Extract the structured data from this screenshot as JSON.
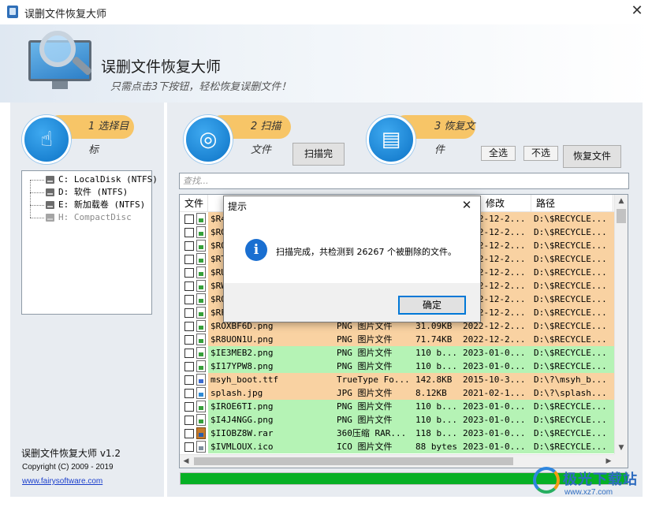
{
  "window": {
    "title": "误删文件恢复大师",
    "close_glyph": "✕"
  },
  "header": {
    "title": "误删文件恢复大师",
    "subtitle": "只需点击3下按钮，轻松恢复误删文件！"
  },
  "steps": [
    {
      "label": "1 选择目标",
      "icon": "hand-pointer-icon"
    },
    {
      "label": "2 扫描文件",
      "icon": "radar-scan-icon"
    },
    {
      "label": "3 恢复文件",
      "icon": "document-search-icon"
    }
  ],
  "buttons": {
    "scan_done": "扫描完",
    "select_all": "全选",
    "select_none": "不选",
    "recover": "恢复文件"
  },
  "drives": [
    {
      "label": "C: LocalDisk (NTFS)",
      "enabled": true
    },
    {
      "label": "D: 软件 (NTFS)",
      "enabled": true
    },
    {
      "label": "E: 新加载卷 (NTFS)",
      "enabled": true
    },
    {
      "label": "H: CompactDisc",
      "enabled": false
    }
  ],
  "search": {
    "placeholder": "查找..."
  },
  "table": {
    "columns": [
      "文件",
      "",
      "",
      "修改",
      "路径"
    ],
    "rows": [
      {
        "name": "$R4",
        "type": "",
        "size": "",
        "date": "2022-12-2...",
        "path": "D:\\$RECYCLE...",
        "color": "orange",
        "icon": "png"
      },
      {
        "name": "$RG",
        "type": "",
        "size": "",
        "date": "2022-12-2...",
        "path": "D:\\$RECYCLE...",
        "color": "orange",
        "icon": "png"
      },
      {
        "name": "$RQ",
        "type": "",
        "size": "",
        "date": "2022-12-2...",
        "path": "D:\\$RECYCLE...",
        "color": "orange",
        "icon": "png"
      },
      {
        "name": "$RT",
        "type": "",
        "size": "",
        "date": "2022-12-2...",
        "path": "D:\\$RECYCLE...",
        "color": "orange",
        "icon": "png"
      },
      {
        "name": "$RU",
        "type": "",
        "size": "",
        "date": "2022-12-2...",
        "path": "D:\\$RECYCLE...",
        "color": "orange",
        "icon": "png"
      },
      {
        "name": "$RW",
        "type": "",
        "size": "",
        "date": "2022-12-2...",
        "path": "D:\\$RECYCLE...",
        "color": "orange",
        "icon": "png"
      },
      {
        "name": "$RO",
        "type": "",
        "size": "",
        "date": "2022-12-2...",
        "path": "D:\\$RECYCLE...",
        "color": "orange",
        "icon": "png"
      },
      {
        "name": "$RF",
        "type": "",
        "size": "",
        "date": "2022-12-2...",
        "path": "D:\\$RECYCLE...",
        "color": "orange",
        "icon": "png"
      },
      {
        "name": "$ROXBF6D.png",
        "type": "PNG 图片文件",
        "size": "31.09KB",
        "date": "2022-12-2...",
        "path": "D:\\$RECYCLE...",
        "color": "orange",
        "icon": "png"
      },
      {
        "name": "$R8UON1U.png",
        "type": "PNG 图片文件",
        "size": "71.74KB",
        "date": "2022-12-2...",
        "path": "D:\\$RECYCLE...",
        "color": "orange",
        "icon": "png"
      },
      {
        "name": "$IE3MEB2.png",
        "type": "PNG 图片文件",
        "size": "110 b...",
        "date": "2023-01-0...",
        "path": "D:\\$RECYCLE...",
        "color": "green",
        "icon": "png"
      },
      {
        "name": "$I17YPW8.png",
        "type": "PNG 图片文件",
        "size": "110 b...",
        "date": "2023-01-0...",
        "path": "D:\\$RECYCLE...",
        "color": "green",
        "icon": "png"
      },
      {
        "name": "msyh_boot.ttf",
        "type": "TrueType Fo...",
        "size": "142.8KB",
        "date": "2015-10-3...",
        "path": "D:\\?\\msyh_b...",
        "color": "orange",
        "icon": "ttf"
      },
      {
        "name": "splash.jpg",
        "type": "JPG 图片文件",
        "size": "8.12KB",
        "date": "2021-02-1...",
        "path": "D:\\?\\splash...",
        "color": "orange",
        "icon": "jpg"
      },
      {
        "name": "$IROE6TI.png",
        "type": "PNG 图片文件",
        "size": "110 b...",
        "date": "2023-01-0...",
        "path": "D:\\$RECYCLE...",
        "color": "green",
        "icon": "png"
      },
      {
        "name": "$I4J4NGG.png",
        "type": "PNG 图片文件",
        "size": "110 b...",
        "date": "2023-01-0...",
        "path": "D:\\$RECYCLE...",
        "color": "green",
        "icon": "png"
      },
      {
        "name": "$IIOBZ8W.rar",
        "type": "360压缩 RAR...",
        "size": "118 b...",
        "date": "2023-01-0...",
        "path": "D:\\$RECYCLE...",
        "color": "green",
        "icon": "rar"
      },
      {
        "name": "$IVMLOUX.ico",
        "type": "ICO 图片文件",
        "size": "88 bytes",
        "date": "2023-01-0...",
        "path": "D:\\$RECYCLE...",
        "color": "green",
        "icon": "ico"
      }
    ]
  },
  "progress": {
    "fraction": 1.0
  },
  "dialog": {
    "title": "提示",
    "message": "扫描完成，共检测到 26267 个被删除的文件。",
    "ok_label": "确定",
    "close_glyph": "✕"
  },
  "about": {
    "name": "误删文件恢复大师 v1.2",
    "copyright": "Copyright (C) 2009 - 2019",
    "link": "www.fairysoftware.com"
  },
  "watermark": {
    "text": "极光下载站",
    "url": "www.xz7.com"
  },
  "colors": {
    "row_orange": "#f9d2a2",
    "row_green": "#b5f3b5",
    "step_pill": "#f7c567",
    "progress": "#06b025",
    "accent": "#0078d7"
  }
}
